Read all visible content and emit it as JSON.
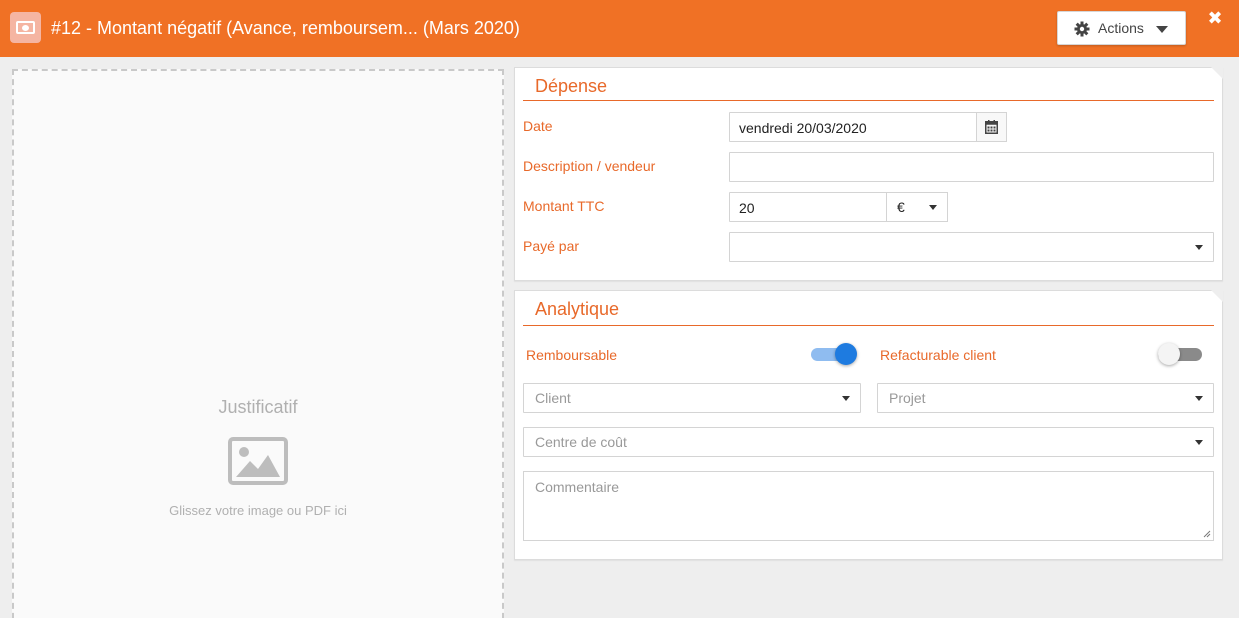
{
  "header": {
    "title": "#12 -  Montant négatif (Avance, remboursem... (Mars 2020)",
    "icon": "banknote-icon",
    "actions_label": "Actions",
    "close_label": "✖",
    "accent_color": "#f07125"
  },
  "dropzone": {
    "title": "Justificatif",
    "hint": "Glissez votre image ou PDF ici",
    "icon": "image-icon"
  },
  "depense": {
    "title": "Dépense",
    "date_label": "Date",
    "date_value": "vendredi 20/03/2020",
    "description_label": "Description / vendeur",
    "description_value": "",
    "amount_label": "Montant TTC",
    "amount_value": "20",
    "currency_value": "€",
    "paid_by_label": "Payé par",
    "paid_by_value": ""
  },
  "analytique": {
    "title": "Analytique",
    "remboursable_label": "Remboursable",
    "remboursable_on": true,
    "refacturable_label": "Refacturable client",
    "refacturable_on": false,
    "client_placeholder": "Client",
    "projet_placeholder": "Projet",
    "centre_placeholder": "Centre de coût",
    "commentaire_placeholder": "Commentaire"
  }
}
